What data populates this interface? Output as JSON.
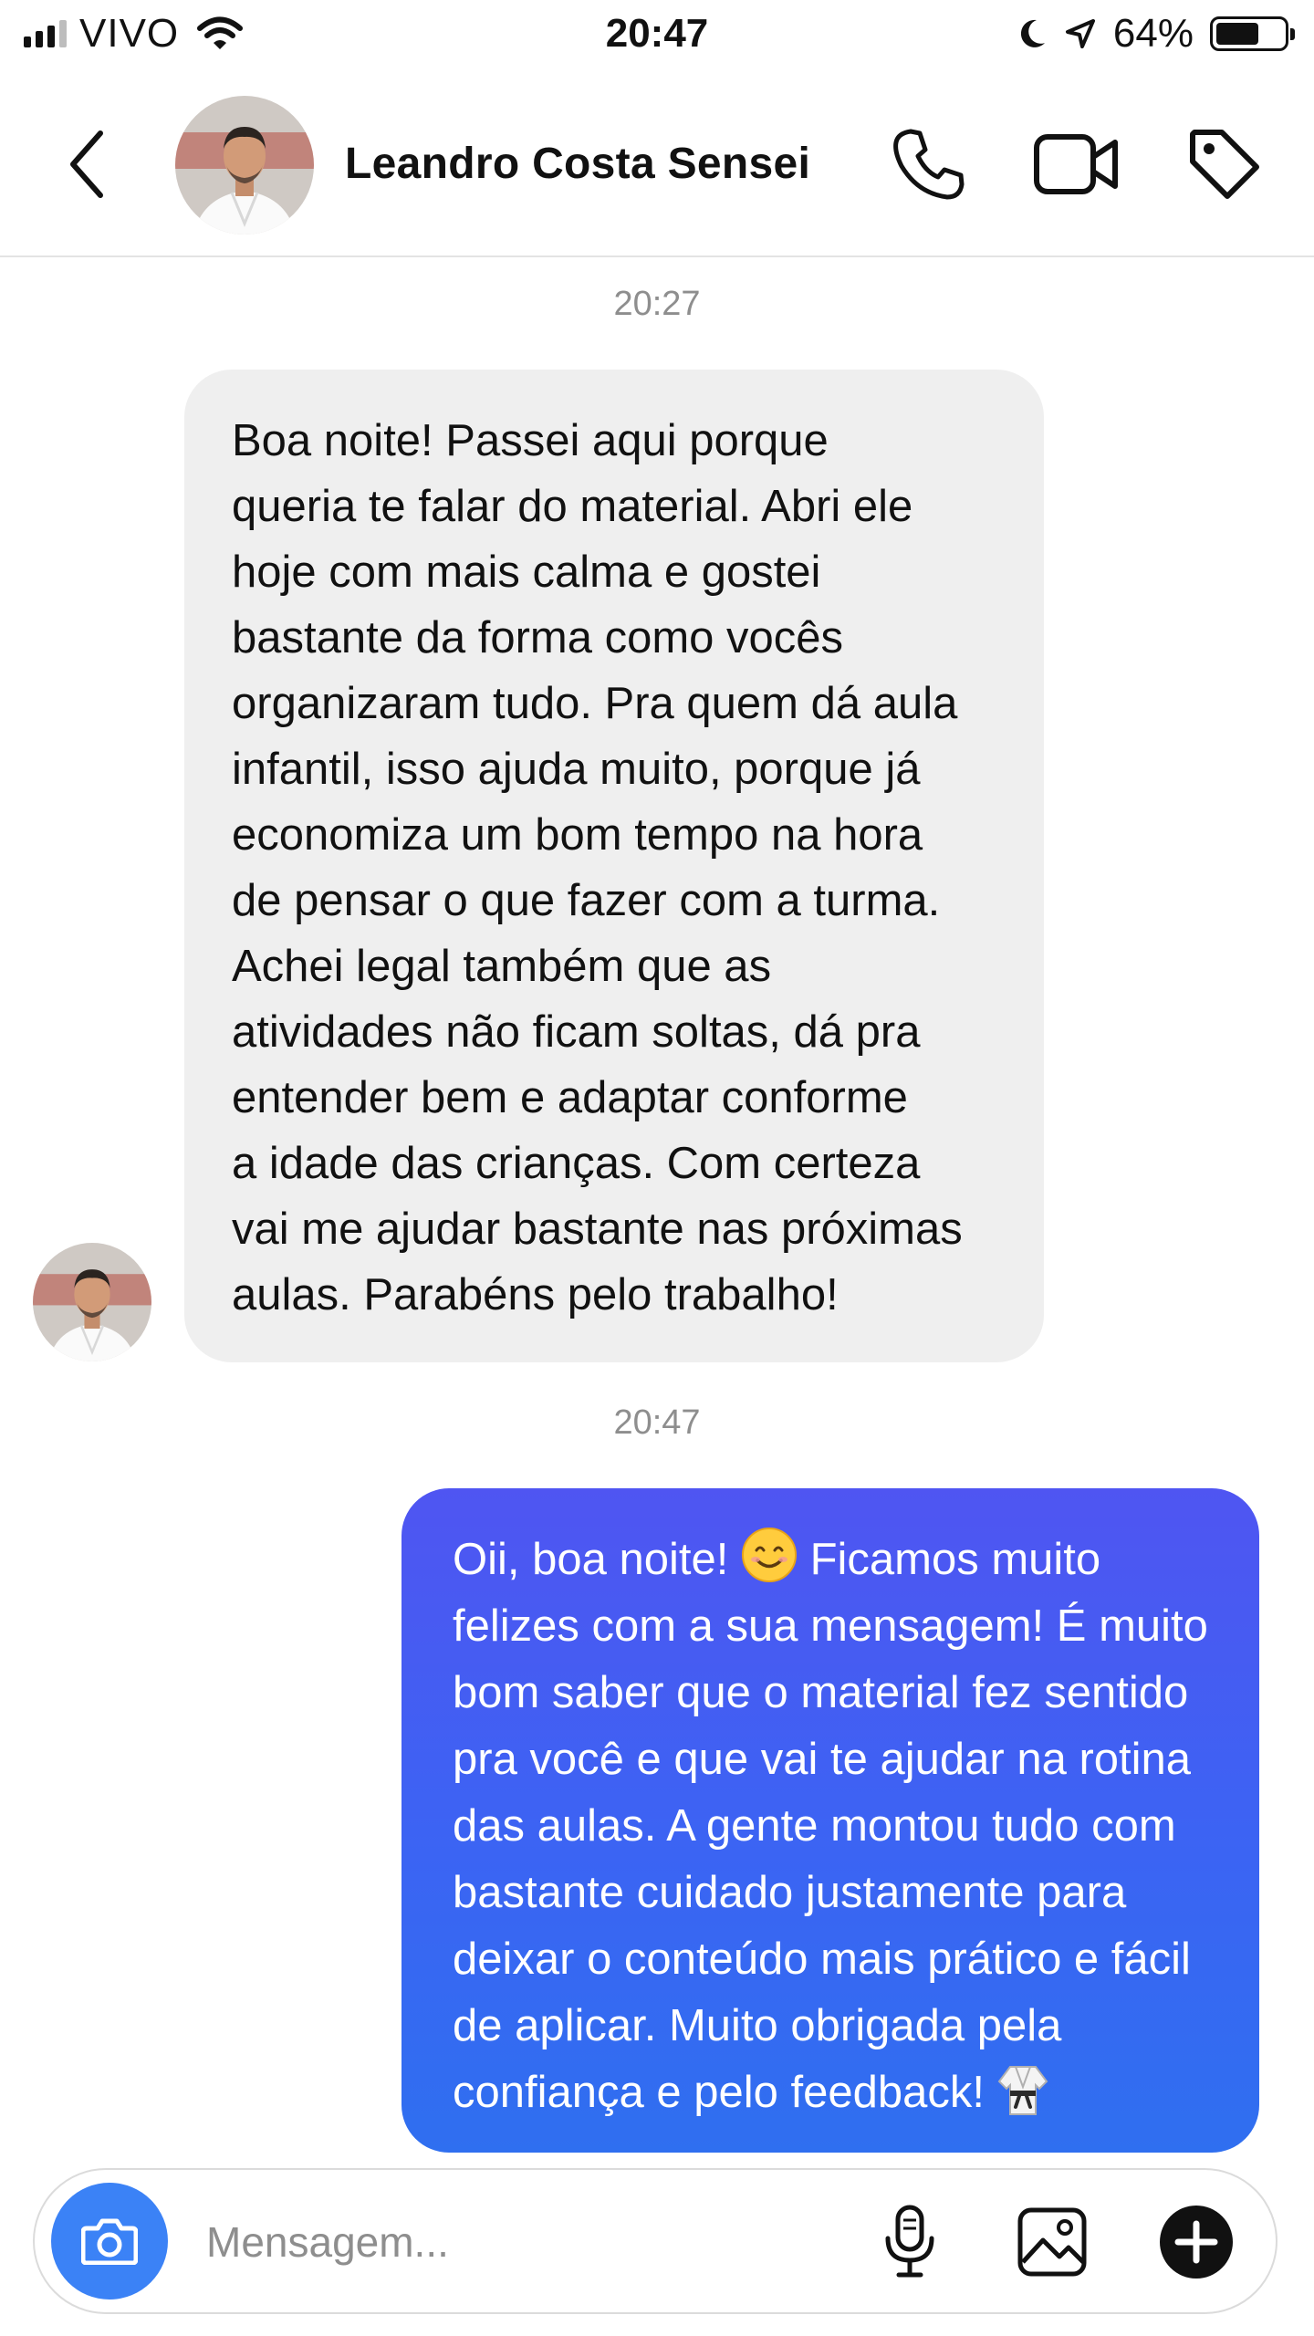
{
  "status_bar": {
    "carrier": "VIVO",
    "time": "20:47",
    "battery_percent": "64%",
    "battery_level": 0.64
  },
  "header": {
    "contact_name": "Leandro Costa Sensei",
    "icons": [
      "back-icon",
      "phone-icon",
      "video-camera-icon",
      "tag-icon"
    ]
  },
  "chat": {
    "messages": [
      {
        "timestamp": "20:27",
        "direction": "incoming",
        "text": "Boa noite! Passei aqui porque\nqueria te falar do material. Abri ele\nhoje com mais calma e gostei\nbastante da forma como vocês\norganizaram tudo. Pra quem dá aula\ninfantil, isso ajuda muito, porque já\neconomiza um bom tempo na hora\nde pensar o que fazer com a turma.\nAchei legal também que as\natividades não ficam soltas, dá pra\nentender bem e adaptar conforme\na idade das crianças. Com certeza\nvai me ajudar bastante nas próximas\naulas. Parabéns pelo trabalho!"
      },
      {
        "timestamp": "20:47",
        "direction": "outgoing",
        "text_before_emoji": "Oii, boa noite! ",
        "emoji_1": "smiling-face-emoji",
        "text_after_emoji": " Ficamos muito\nfelizes com a sua mensagem! É muito\nbom saber que o material fez sentido\npra você e que vai te ajudar na rotina\ndas aulas. A gente montou tudo com\nbastante cuidado justamente para\ndeixar o conteúdo mais prático e fácil\nde aplicar. Muito obrigada pela\nconfiança e pelo feedback! ",
        "emoji_2": "martial-arts-uniform-emoji"
      }
    ]
  },
  "composer": {
    "placeholder": "Mensagem...",
    "icons": [
      "camera-icon",
      "microphone-icon",
      "gallery-icon",
      "plus-icon"
    ]
  },
  "colors": {
    "outgoing_bubble_top": "#4f55f2",
    "outgoing_bubble_bottom": "#2f6ff0",
    "incoming_bubble": "#efefef",
    "camera_button": "#3b82f6",
    "timestamp_text": "#8e8e8e"
  }
}
